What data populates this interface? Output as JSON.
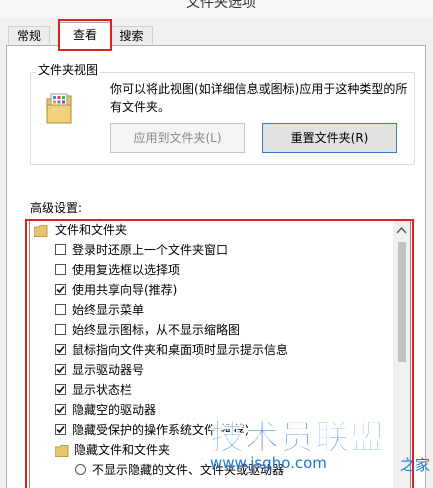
{
  "window": {
    "title": "文件夹选项"
  },
  "tabs": [
    {
      "label": "常规"
    },
    {
      "label": "查看"
    },
    {
      "label": "搜索"
    }
  ],
  "folder_views": {
    "title": "文件夹视图",
    "description": "你可以将此视图(如详细信息或图标)应用于这种类型的所有文件夹。",
    "apply_button": "应用到文件夹(L)",
    "reset_button": "重置文件夹(R)"
  },
  "advanced": {
    "label": "高级设置:",
    "items": [
      {
        "type": "folder",
        "label": "文件和文件夹"
      },
      {
        "type": "checkbox",
        "label": "登录时还原上一个文件夹窗口",
        "checked": false
      },
      {
        "type": "checkbox",
        "label": "使用复选框以选择项",
        "checked": false
      },
      {
        "type": "checkbox",
        "label": "使用共享向导(推荐)",
        "checked": true
      },
      {
        "type": "checkbox",
        "label": "始终显示菜单",
        "checked": false
      },
      {
        "type": "checkbox",
        "label": "始终显示图标，从不显示缩略图",
        "checked": false
      },
      {
        "type": "checkbox",
        "label": "鼠标指向文件夹和桌面项时显示提示信息",
        "checked": true
      },
      {
        "type": "checkbox",
        "label": "显示驱动器号",
        "checked": true
      },
      {
        "type": "checkbox",
        "label": "显示状态栏",
        "checked": true
      },
      {
        "type": "checkbox",
        "label": "隐藏空的驱动器",
        "checked": true
      },
      {
        "type": "checkbox",
        "label": "隐藏受保护的操作系统文件(推荐)",
        "checked": true
      },
      {
        "type": "folder",
        "label": "隐藏文件和文件夹"
      },
      {
        "type": "radio",
        "label": "不显示隐藏的文件、文件夹或驱动器",
        "checked": false
      }
    ]
  },
  "watermark": {
    "main": "技术员联盟",
    "sub": "www.jsgho.com",
    "tail": "之家"
  },
  "colors": {
    "highlight": "#e02020",
    "focus_border": "#2a7fd3",
    "watermark": "#1a78d4"
  }
}
